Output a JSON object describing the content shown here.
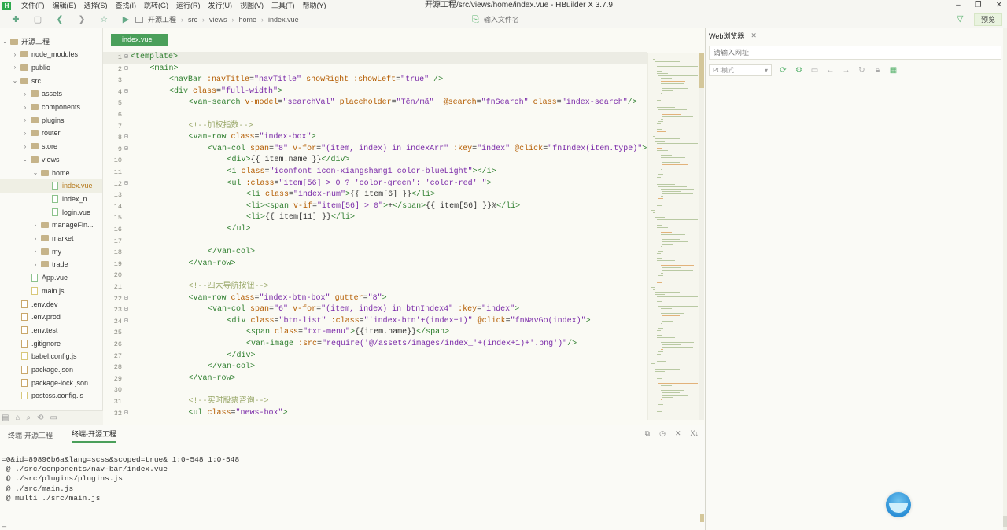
{
  "window": {
    "title": "开源工程/src/views/home/index.vue - HBuilder X 3.7.9",
    "logo": "H",
    "controls": [
      "–",
      "❐",
      "✕"
    ]
  },
  "menu": [
    "文件(F)",
    "编辑(E)",
    "选择(S)",
    "查找(I)",
    "跳转(G)",
    "运行(R)",
    "发行(U)",
    "视图(V)",
    "工具(T)",
    "帮助(Y)"
  ],
  "toolbar": {
    "breadcrumb": [
      "开源工程",
      "src",
      "views",
      "home",
      "index.vue"
    ],
    "file_search_placeholder": "输入文件名",
    "preview_label": "预览"
  },
  "sidebar": {
    "items": [
      {
        "label": "开源工程",
        "depth": 0,
        "kind": "project",
        "open": true
      },
      {
        "label": "node_modules",
        "depth": 1,
        "kind": "folder",
        "open": false
      },
      {
        "label": "public",
        "depth": 1,
        "kind": "folder",
        "open": false
      },
      {
        "label": "src",
        "depth": 1,
        "kind": "folder",
        "open": true
      },
      {
        "label": "assets",
        "depth": 2,
        "kind": "folder",
        "open": false
      },
      {
        "label": "components",
        "depth": 2,
        "kind": "folder",
        "open": false
      },
      {
        "label": "plugins",
        "depth": 2,
        "kind": "folder",
        "open": false
      },
      {
        "label": "router",
        "depth": 2,
        "kind": "folder",
        "open": false
      },
      {
        "label": "store",
        "depth": 2,
        "kind": "folder",
        "open": false
      },
      {
        "label": "views",
        "depth": 2,
        "kind": "folder",
        "open": true
      },
      {
        "label": "home",
        "depth": 3,
        "kind": "folder",
        "open": true
      },
      {
        "label": "index.vue",
        "depth": 4,
        "kind": "vue",
        "selected": true
      },
      {
        "label": "index_n...",
        "depth": 4,
        "kind": "vue"
      },
      {
        "label": "login.vue",
        "depth": 4,
        "kind": "vue"
      },
      {
        "label": "manageFin...",
        "depth": 3,
        "kind": "folder",
        "open": false
      },
      {
        "label": "market",
        "depth": 3,
        "kind": "folder",
        "open": false
      },
      {
        "label": "my",
        "depth": 3,
        "kind": "folder",
        "open": false
      },
      {
        "label": "trade",
        "depth": 3,
        "kind": "folder",
        "open": false
      },
      {
        "label": "App.vue",
        "depth": 2,
        "kind": "vue"
      },
      {
        "label": "main.js",
        "depth": 2,
        "kind": "js"
      },
      {
        "label": ".env.dev",
        "depth": 1,
        "kind": "file"
      },
      {
        "label": ".env.prod",
        "depth": 1,
        "kind": "file"
      },
      {
        "label": ".env.test",
        "depth": 1,
        "kind": "file"
      },
      {
        "label": ".gitignore",
        "depth": 1,
        "kind": "file"
      },
      {
        "label": "babel.config.js",
        "depth": 1,
        "kind": "js"
      },
      {
        "label": "package.json",
        "depth": 1,
        "kind": "json"
      },
      {
        "label": "package-lock.json",
        "depth": 1,
        "kind": "json"
      },
      {
        "label": "postcss.config.js",
        "depth": 1,
        "kind": "js"
      }
    ]
  },
  "editor": {
    "tab": "index.vue",
    "current_line": 1,
    "lines": [
      {
        "n": "1",
        "fold": "⊟",
        "indent": 0,
        "parts": [
          [
            "t",
            "<template>"
          ]
        ]
      },
      {
        "n": "2",
        "fold": "⊟",
        "indent": 1,
        "parts": [
          [
            "t",
            "<main>"
          ]
        ]
      },
      {
        "n": "3",
        "fold": "",
        "indent": 2,
        "parts": [
          [
            "t",
            "<navBar "
          ],
          [
            "a",
            ":navTitle"
          ],
          [
            "o",
            "="
          ],
          [
            "s",
            "\"navTitle\""
          ],
          [
            "a",
            " showRight :showLeft"
          ],
          [
            "o",
            "="
          ],
          [
            "s",
            "\"true\""
          ],
          [
            "t",
            " />"
          ]
        ]
      },
      {
        "n": "4",
        "fold": "⊟",
        "indent": 2,
        "parts": [
          [
            "t",
            "<div "
          ],
          [
            "a",
            "class"
          ],
          [
            "o",
            "="
          ],
          [
            "s",
            "\"full-width\""
          ],
          [
            "t",
            ">"
          ]
        ]
      },
      {
        "n": "5",
        "fold": "",
        "indent": 3,
        "parts": [
          [
            "t",
            "<van-search "
          ],
          [
            "a",
            "v-model"
          ],
          [
            "o",
            "="
          ],
          [
            "s",
            "\"searchVal\""
          ],
          [
            "a",
            " placeholder"
          ],
          [
            "o",
            "="
          ],
          [
            "s",
            "\"Tên/mã\""
          ],
          [
            "a",
            "  @search"
          ],
          [
            "o",
            "="
          ],
          [
            "s",
            "\"fnSearch\""
          ],
          [
            "a",
            " class"
          ],
          [
            "o",
            "="
          ],
          [
            "s",
            "\"index-search\""
          ],
          [
            "t",
            "/>"
          ]
        ]
      },
      {
        "n": "6",
        "fold": "",
        "indent": 3,
        "parts": []
      },
      {
        "n": "7",
        "fold": "",
        "indent": 3,
        "parts": [
          [
            "c",
            "<!--加权指数-->"
          ]
        ]
      },
      {
        "n": "8",
        "fold": "⊟",
        "indent": 3,
        "parts": [
          [
            "t",
            "<van-row "
          ],
          [
            "a",
            "class"
          ],
          [
            "o",
            "="
          ],
          [
            "s",
            "\"index-box\""
          ],
          [
            "t",
            ">"
          ]
        ]
      },
      {
        "n": "9",
        "fold": "⊟",
        "indent": 4,
        "parts": [
          [
            "t",
            "<van-col "
          ],
          [
            "a",
            "span"
          ],
          [
            "o",
            "="
          ],
          [
            "s",
            "\"8\""
          ],
          [
            "a",
            " v-for"
          ],
          [
            "o",
            "="
          ],
          [
            "s",
            "\"(item, index) in indexArr\""
          ],
          [
            "a",
            " :key"
          ],
          [
            "o",
            "="
          ],
          [
            "s",
            "\"index\""
          ],
          [
            "a",
            " @click"
          ],
          [
            "o",
            "="
          ],
          [
            "s",
            "\"fnIndex(item.type)\""
          ],
          [
            "t",
            ">"
          ]
        ]
      },
      {
        "n": "10",
        "fold": "",
        "indent": 5,
        "parts": [
          [
            "t",
            "<div>"
          ],
          [
            "o",
            "{{ item.name }}"
          ],
          [
            "t",
            "</div>"
          ]
        ]
      },
      {
        "n": "11",
        "fold": "",
        "indent": 5,
        "parts": [
          [
            "t",
            "<i "
          ],
          [
            "a",
            "class"
          ],
          [
            "o",
            "="
          ],
          [
            "s",
            "\"iconfont icon-xiangshang1 color-blueLight\""
          ],
          [
            "t",
            "></i>"
          ]
        ]
      },
      {
        "n": "12",
        "fold": "⊟",
        "indent": 5,
        "parts": [
          [
            "t",
            "<ul "
          ],
          [
            "a",
            ":class"
          ],
          [
            "o",
            "="
          ],
          [
            "s",
            "\"item[56] > 0 ? 'color-green': 'color-red' \""
          ],
          [
            "t",
            ">"
          ]
        ]
      },
      {
        "n": "13",
        "fold": "",
        "indent": 6,
        "parts": [
          [
            "t",
            "<li "
          ],
          [
            "a",
            "class"
          ],
          [
            "o",
            "="
          ],
          [
            "s",
            "\"index-num\""
          ],
          [
            "t",
            ">"
          ],
          [
            "o",
            "{{ item[6] }}"
          ],
          [
            "t",
            "</li>"
          ]
        ]
      },
      {
        "n": "14",
        "fold": "",
        "indent": 6,
        "parts": [
          [
            "t",
            "<li><span "
          ],
          [
            "a",
            "v-if"
          ],
          [
            "o",
            "="
          ],
          [
            "s",
            "\"item[56] > 0\""
          ],
          [
            "t",
            ">"
          ],
          [
            "o",
            "+"
          ],
          [
            "t",
            "</span>"
          ],
          [
            "o",
            "{{ item[56] }}%"
          ],
          [
            "t",
            "</li>"
          ]
        ]
      },
      {
        "n": "15",
        "fold": "",
        "indent": 6,
        "parts": [
          [
            "t",
            "<li>"
          ],
          [
            "o",
            "{{ item[11] }}"
          ],
          [
            "t",
            "</li>"
          ]
        ]
      },
      {
        "n": "16",
        "fold": "",
        "indent": 5,
        "parts": [
          [
            "t",
            "</ul>"
          ]
        ]
      },
      {
        "n": "17",
        "fold": "",
        "indent": 5,
        "parts": []
      },
      {
        "n": "18",
        "fold": "",
        "indent": 4,
        "parts": [
          [
            "t",
            "</van-col>"
          ]
        ]
      },
      {
        "n": "19",
        "fold": "",
        "indent": 3,
        "parts": [
          [
            "t",
            "</van-row>"
          ]
        ]
      },
      {
        "n": "20",
        "fold": "",
        "indent": 3,
        "parts": []
      },
      {
        "n": "21",
        "fold": "",
        "indent": 3,
        "parts": [
          [
            "c",
            "<!--四大导航按钮-->"
          ]
        ]
      },
      {
        "n": "22",
        "fold": "⊟",
        "indent": 3,
        "parts": [
          [
            "t",
            "<van-row "
          ],
          [
            "a",
            "class"
          ],
          [
            "o",
            "="
          ],
          [
            "s",
            "\"index-btn-box\""
          ],
          [
            "a",
            " gutter"
          ],
          [
            "o",
            "="
          ],
          [
            "s",
            "\"8\""
          ],
          [
            "t",
            ">"
          ]
        ]
      },
      {
        "n": "23",
        "fold": "⊟",
        "indent": 4,
        "parts": [
          [
            "t",
            "<van-col "
          ],
          [
            "a",
            "span"
          ],
          [
            "o",
            "="
          ],
          [
            "s",
            "\"6\""
          ],
          [
            "a",
            " v-for"
          ],
          [
            "o",
            "="
          ],
          [
            "s",
            "\"(item, index) in btnIndex4\""
          ],
          [
            "a",
            " :key"
          ],
          [
            "o",
            "="
          ],
          [
            "s",
            "\"index\""
          ],
          [
            "t",
            ">"
          ]
        ]
      },
      {
        "n": "24",
        "fold": "⊟",
        "indent": 5,
        "parts": [
          [
            "t",
            "<div "
          ],
          [
            "a",
            "class"
          ],
          [
            "o",
            "="
          ],
          [
            "s",
            "\"btn-list\""
          ],
          [
            "a",
            " :class"
          ],
          [
            "o",
            "="
          ],
          [
            "s",
            "\"'index-btn'+(index+1)\""
          ],
          [
            "a",
            " @click"
          ],
          [
            "o",
            "="
          ],
          [
            "s",
            "\"fnNavGo(index)\""
          ],
          [
            "t",
            ">"
          ]
        ]
      },
      {
        "n": "25",
        "fold": "",
        "indent": 6,
        "parts": [
          [
            "t",
            "<span "
          ],
          [
            "a",
            "class"
          ],
          [
            "o",
            "="
          ],
          [
            "s",
            "\"txt-menu\""
          ],
          [
            "t",
            ">"
          ],
          [
            "o",
            "{{item.name}}"
          ],
          [
            "t",
            "</span>"
          ]
        ]
      },
      {
        "n": "26",
        "fold": "",
        "indent": 6,
        "parts": [
          [
            "t",
            "<van-image "
          ],
          [
            "a",
            ":src"
          ],
          [
            "o",
            "="
          ],
          [
            "s",
            "\"require('@/assets/images/index_'+(index+1)+'.png')\""
          ],
          [
            "t",
            "/>"
          ]
        ]
      },
      {
        "n": "27",
        "fold": "",
        "indent": 5,
        "parts": [
          [
            "t",
            "</div>"
          ]
        ]
      },
      {
        "n": "28",
        "fold": "",
        "indent": 4,
        "parts": [
          [
            "t",
            "</van-col>"
          ]
        ]
      },
      {
        "n": "29",
        "fold": "",
        "indent": 3,
        "parts": [
          [
            "t",
            "</van-row>"
          ]
        ]
      },
      {
        "n": "30",
        "fold": "",
        "indent": 3,
        "parts": []
      },
      {
        "n": "31",
        "fold": "",
        "indent": 3,
        "parts": [
          [
            "c",
            "<!--实时股票咨询-->"
          ]
        ]
      },
      {
        "n": "32",
        "fold": "⊟",
        "indent": 3,
        "parts": [
          [
            "t",
            "<ul "
          ],
          [
            "a",
            "class"
          ],
          [
            "o",
            "="
          ],
          [
            "s",
            "\"news-box\""
          ],
          [
            "t",
            ">"
          ]
        ]
      }
    ]
  },
  "terminal": {
    "tabs": [
      "终端-开源工程",
      "终端-开源工程"
    ],
    "active_tab": 1,
    "actions": [
      "⧉",
      "◷",
      "✕",
      "X↓"
    ],
    "output": [
      "=0&id=89896b6a&lang=scss&scoped=true& 1:0-548 1:0-548",
      " @ ./src/components/nav-bar/index.vue",
      " @ ./src/plugins/plugins.js",
      " @ ./src/main.js",
      " @ multi ./src/main.js"
    ],
    "prompt": "_"
  },
  "browser": {
    "tab_label": "Web浏览器",
    "url_placeholder": "请输入网址",
    "mode": "PC模式"
  },
  "colors": {
    "accent": "#4a9f5a",
    "tag": "#2f7f2f",
    "attr": "#b45c00",
    "string": "#7a2aa8",
    "comment": "#9aa86a"
  }
}
